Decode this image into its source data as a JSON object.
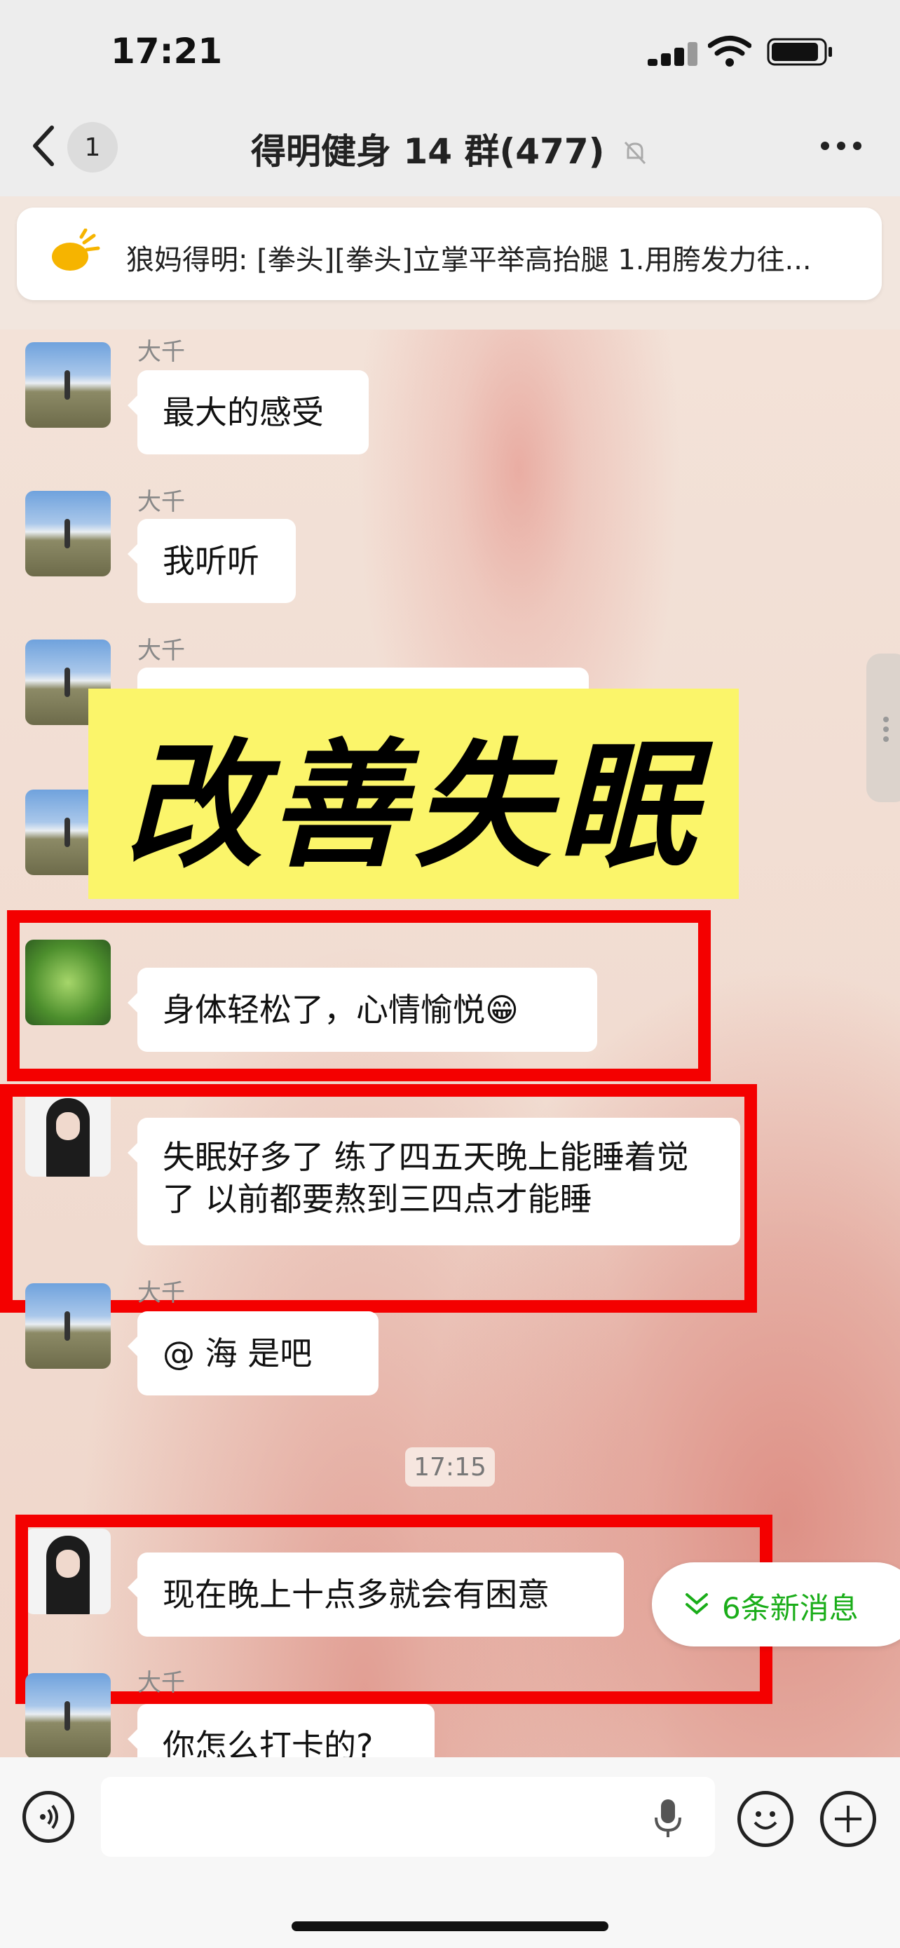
{
  "status_bar": {
    "time": "17:21"
  },
  "nav": {
    "title": "得明健身 14 群(477)",
    "unread_badge": "1",
    "icons": [
      "back-chevron-icon",
      "mute-bell-icon",
      "more-dots-icon"
    ]
  },
  "pinned": {
    "icon": "megaphone-icon",
    "text": "狼妈得明: [拳头][拳头]立掌平举高抬腿  1.用胯发力往..."
  },
  "messages": [
    {
      "sender": "大千",
      "text": "最大的感受"
    },
    {
      "sender": "大千",
      "text": "我听听"
    },
    {
      "sender": "大千",
      "text": ""
    },
    {
      "sender": "",
      "text": "身体轻松了，心情愉悦😁"
    },
    {
      "sender": "",
      "text": "失眠好多了 练了四五天晚上能睡着觉了 以前都要熬到三四点才能睡"
    },
    {
      "sender": "大千",
      "text": "@  海 是吧"
    },
    {
      "sender": "",
      "text": "现在晚上十点多就会有困意"
    },
    {
      "sender": "大千",
      "text": "你怎么打卡的?"
    }
  ],
  "time_divider": "17:15",
  "overlay_banner": "改善失眠",
  "new_messages_pill": "6条新消息",
  "colors": {
    "highlight_red": "#f40000",
    "banner_yellow": "#fbf56a",
    "wechat_green": "#1aad19"
  }
}
